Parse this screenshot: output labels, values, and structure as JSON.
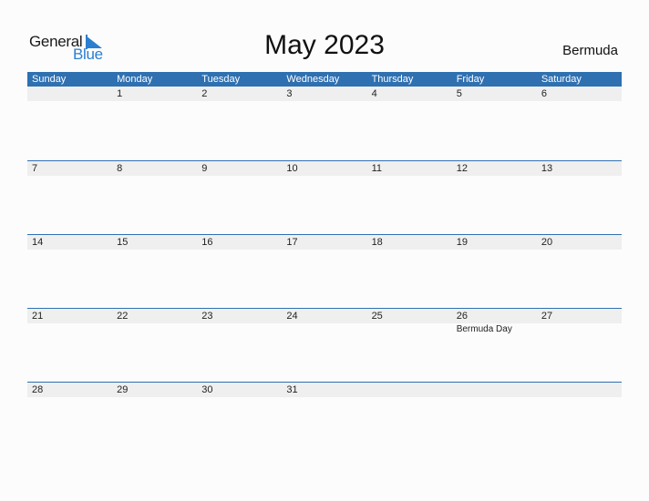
{
  "logo": {
    "part1": "General",
    "part2": "Blue"
  },
  "title": "May 2023",
  "country": "Bermuda",
  "colors": {
    "header_bg": "#2f70b1",
    "date_strip": "#efefef",
    "logo_blue": "#2a7fd0"
  },
  "weekdays": [
    "Sunday",
    "Monday",
    "Tuesday",
    "Wednesday",
    "Thursday",
    "Friday",
    "Saturday"
  ],
  "weeks": [
    {
      "days": [
        "",
        "1",
        "2",
        "3",
        "4",
        "5",
        "6"
      ],
      "events": [
        "",
        "",
        "",
        "",
        "",
        "",
        ""
      ]
    },
    {
      "days": [
        "7",
        "8",
        "9",
        "10",
        "11",
        "12",
        "13"
      ],
      "events": [
        "",
        "",
        "",
        "",
        "",
        "",
        ""
      ]
    },
    {
      "days": [
        "14",
        "15",
        "16",
        "17",
        "18",
        "19",
        "20"
      ],
      "events": [
        "",
        "",
        "",
        "",
        "",
        "",
        ""
      ]
    },
    {
      "days": [
        "21",
        "22",
        "23",
        "24",
        "25",
        "26",
        "27"
      ],
      "events": [
        "",
        "",
        "",
        "",
        "",
        "Bermuda Day",
        ""
      ]
    },
    {
      "days": [
        "28",
        "29",
        "30",
        "31",
        "",
        "",
        ""
      ],
      "events": [
        "",
        "",
        "",
        "",
        "",
        "",
        ""
      ]
    }
  ]
}
